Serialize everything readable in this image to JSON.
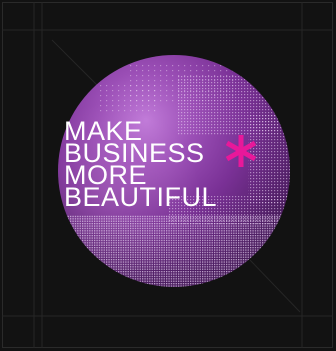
{
  "poster": {
    "headline_lines": [
      "MAKE",
      "BUSINESS",
      "MORE",
      "BEAUTIFUL"
    ]
  },
  "icons": {
    "accent_mark": "asterisk-icon"
  },
  "colors": {
    "background": "#121212",
    "disc_light": "#c07ad8",
    "disc_dark": "#2c0f3a",
    "accent": "#e8189a",
    "text": "#ffffff"
  }
}
